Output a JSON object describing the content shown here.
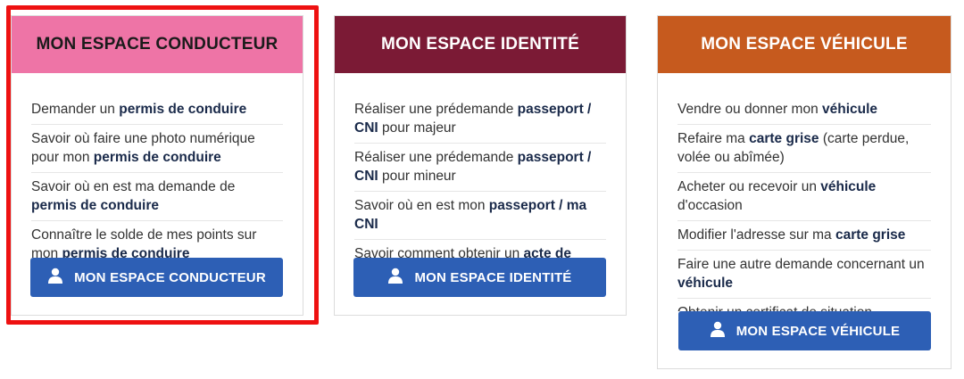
{
  "cards": [
    {
      "title": "MON ESPACE CONDUCTEUR",
      "header_color": "#ee74a6",
      "header_text_color": "#1b1b1b",
      "links": [
        [
          {
            "t": "Demander un "
          },
          {
            "t": "permis de conduire",
            "b": true
          }
        ],
        [
          {
            "t": "Savoir où faire une photo numérique pour mon "
          },
          {
            "t": "permis de conduire",
            "b": true
          }
        ],
        [
          {
            "t": "Savoir où en est ma demande de "
          },
          {
            "t": "permis de conduire",
            "b": true
          }
        ],
        [
          {
            "t": "Connaître le solde de mes points sur mon "
          },
          {
            "t": "permis de conduire",
            "b": true
          }
        ]
      ],
      "button_label": "MON ESPACE CONDUCTEUR"
    },
    {
      "title": "MON ESPACE IDENTITÉ",
      "header_color": "#7b1a35",
      "header_text_color": "#ffffff",
      "links": [
        [
          {
            "t": "Réaliser une prédemande "
          },
          {
            "t": "passeport / CNI",
            "b": true
          },
          {
            "t": " pour majeur"
          }
        ],
        [
          {
            "t": "Réaliser une prédemande "
          },
          {
            "t": "passeport / CNI",
            "b": true
          },
          {
            "t": " pour mineur"
          }
        ],
        [
          {
            "t": "Savoir où en est mon "
          },
          {
            "t": "passeport / ma CNI",
            "b": true
          }
        ],
        [
          {
            "t": "Savoir comment obtenir un "
          },
          {
            "t": "acte de",
            "b": true
          }
        ]
      ],
      "button_label": "MON ESPACE IDENTITÉ"
    },
    {
      "title": "MON ESPACE VÉHICULE",
      "header_color": "#c65a1e",
      "header_text_color": "#ffffff",
      "links": [
        [
          {
            "t": "Vendre ou donner mon "
          },
          {
            "t": "véhicule",
            "b": true
          }
        ],
        [
          {
            "t": "Refaire ma "
          },
          {
            "t": "carte grise",
            "b": true
          },
          {
            "t": " (carte perdue, volée ou abîmée)"
          }
        ],
        [
          {
            "t": "Acheter ou recevoir un "
          },
          {
            "t": "véhicule",
            "b": true
          },
          {
            "t": " d'occasion"
          }
        ],
        [
          {
            "t": "Modifier l'adresse sur ma "
          },
          {
            "t": "carte grise",
            "b": true
          }
        ],
        [
          {
            "t": "Faire une autre demande concernant un "
          },
          {
            "t": "véhicule",
            "b": true
          }
        ],
        [
          {
            "t": "Obtenir un certificat de situation"
          }
        ]
      ],
      "button_label": "MON ESPACE VÉHICULE"
    }
  ],
  "button_icon": "user-icon",
  "highlight_color": "#ee1111"
}
